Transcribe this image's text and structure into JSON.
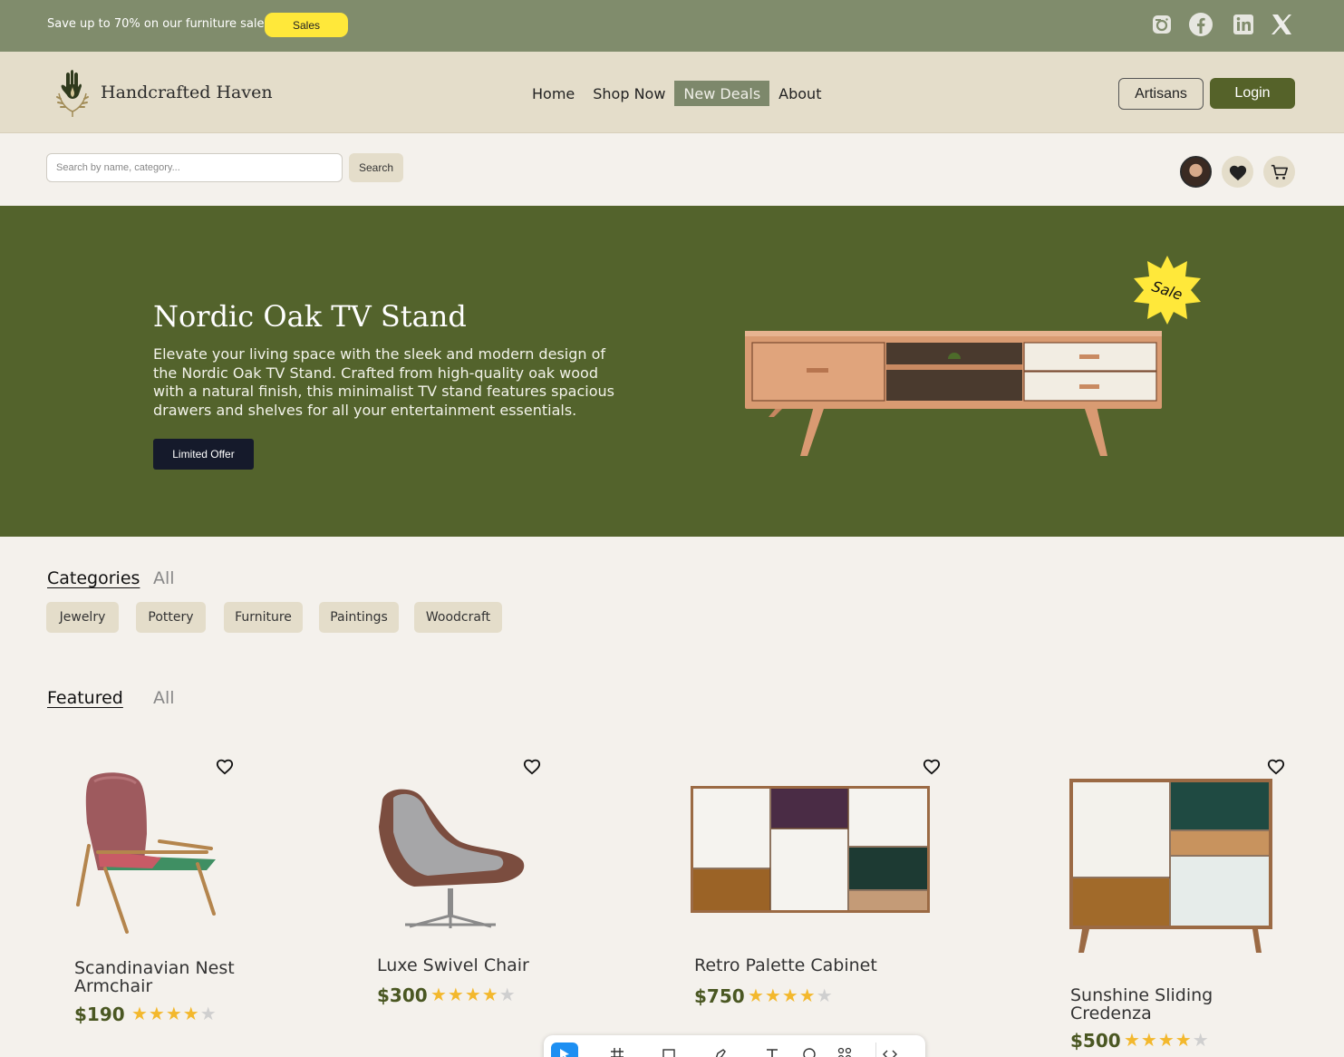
{
  "promo": {
    "text": "Save up to 70% on our furniture sales",
    "sales_label": "Sales",
    "social_icons": [
      "instagram-icon",
      "facebook-icon",
      "linkedin-icon",
      "x-icon"
    ]
  },
  "brand": {
    "name": "Handcrafted Haven"
  },
  "nav": {
    "links": [
      {
        "label": "Home"
      },
      {
        "label": "Shop Now"
      },
      {
        "label": "New Deals",
        "active": true
      },
      {
        "label": "About"
      }
    ],
    "artisans_label": "Artisans",
    "login_label": "Login"
  },
  "search": {
    "placeholder": "Search by name, category...",
    "value": "",
    "button_label": "Search"
  },
  "hero": {
    "title": "Nordic Oak TV Stand",
    "description": "Elevate your living space with the sleek and modern design of the Nordic Oak TV Stand. Crafted from high-quality oak wood with a natural finish, this minimalist TV stand features spacious drawers and shelves for all your entertainment essentials.",
    "button_label": "Limited Offer",
    "badge": "Sale"
  },
  "categories": {
    "title": "Categories",
    "all_label": "All",
    "items": [
      "Jewelry",
      "Pottery",
      "Furniture",
      "Paintings",
      "Woodcraft"
    ]
  },
  "featured": {
    "title": "Featured",
    "all_label": "All",
    "products": [
      {
        "name_line1": "Scandinavian Nest",
        "name_line2": "Armchair",
        "price": "$190",
        "rating": 4
      },
      {
        "name_line1": "Luxe Swivel Chair",
        "name_line2": "",
        "price": "$300",
        "rating": 4
      },
      {
        "name_line1": "Retro Palette Cabinet",
        "name_line2": "",
        "price": "$750",
        "rating": 4
      },
      {
        "name_line1": "Sunshine Sliding",
        "name_line2": "Credenza",
        "price": "$500",
        "rating": 4
      }
    ]
  },
  "colors": {
    "promo_bg": "#808c6c",
    "nav_bg": "#e4ddca",
    "hero_bg": "#53632c",
    "accent_yellow": "#ffe83a",
    "login_bg": "#556229",
    "price": "#4a5722",
    "star": "#f3b82d"
  }
}
